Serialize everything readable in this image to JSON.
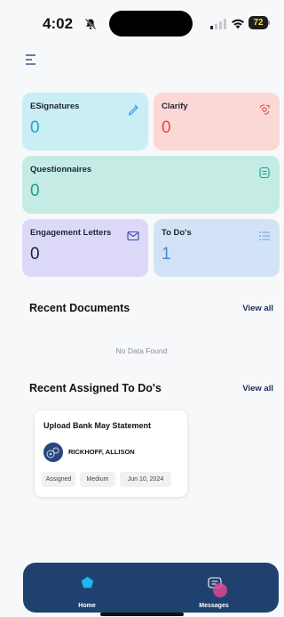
{
  "status_bar": {
    "time": "4:02",
    "battery": "72"
  },
  "cards": {
    "esignatures": {
      "title": "ESignatures",
      "count": "0",
      "count_color": "#1aa5c8"
    },
    "clarify": {
      "title": "Clarify",
      "count": "0",
      "count_color": "#e04a44"
    },
    "questionnaires": {
      "title": "Questionnaires",
      "count": "0",
      "count_color": "#1aa08a"
    },
    "engagement_letters": {
      "title": "Engagement Letters",
      "count": "0",
      "count_color": "#1d2433"
    },
    "todos": {
      "title": "To Do's",
      "count": "1",
      "count_color": "#4a8bd8"
    }
  },
  "recent_documents": {
    "title": "Recent Documents",
    "view_all": "View all",
    "empty_text": "No Data Found"
  },
  "recent_todos": {
    "title": "Recent Assigned To Do's",
    "view_all": "View all",
    "items": [
      {
        "title": "Upload Bank May Statement",
        "assignee": "RICKHOFF, ALLISON",
        "status": "Assigned",
        "priority": "Medium",
        "date": "Jun 10, 2024"
      }
    ]
  },
  "bottom_nav": {
    "home_label": "Home",
    "messages_label": "Messages"
  },
  "icons": {
    "menu": "hamburger-menu-icon",
    "esignatures": "pen-icon",
    "clarify": "clarify-icon",
    "questionnaires": "document-list-icon",
    "engagement_letters": "envelope-icon",
    "todos": "list-icon",
    "home": "home-icon",
    "messages": "message-icon"
  }
}
